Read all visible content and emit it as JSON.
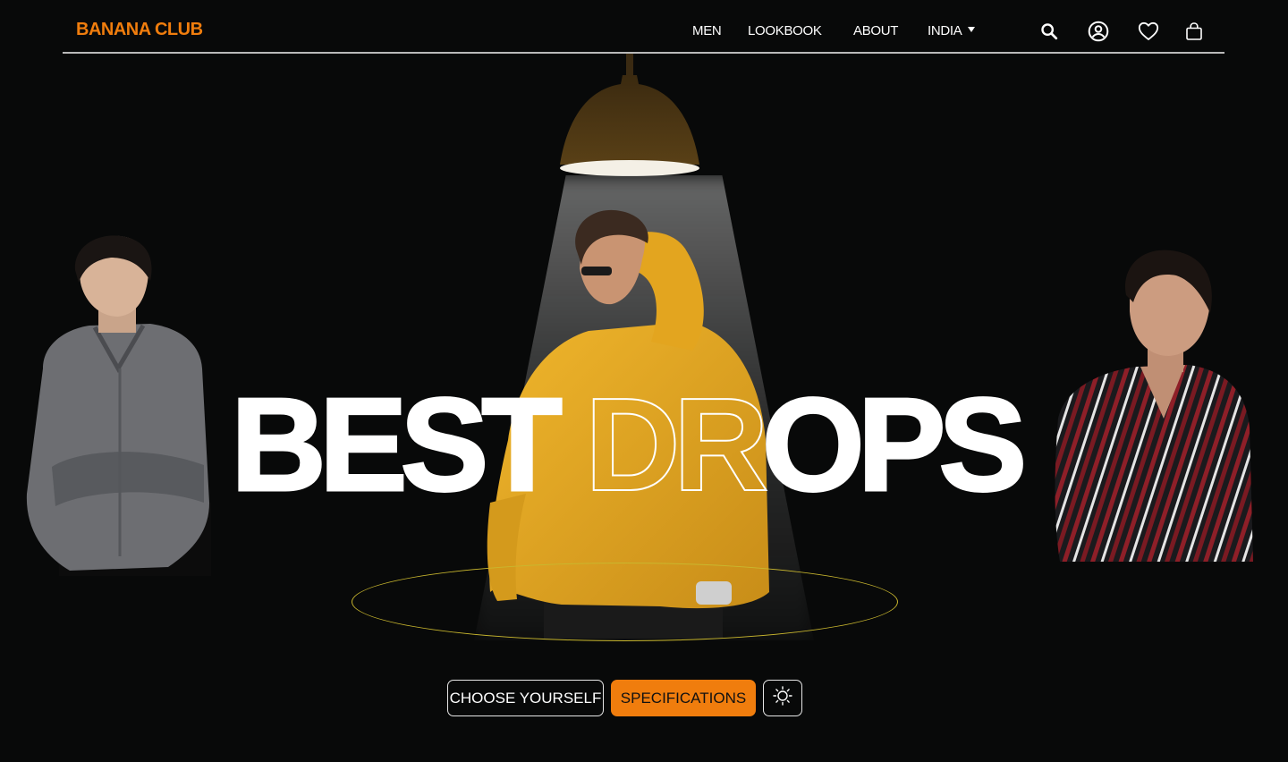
{
  "brand": {
    "name": "BANANA CLUB",
    "color": "#f07d0d"
  },
  "nav": {
    "items": [
      {
        "label": "MEN"
      },
      {
        "label": "LOOKBOOK"
      },
      {
        "label": "ABOUT"
      },
      {
        "label": "INDIA"
      }
    ],
    "icons": [
      "search-icon",
      "user-icon",
      "heart-icon",
      "bag-icon"
    ]
  },
  "hero": {
    "headline_solid_1": "BEST",
    "headline_outline": "DR",
    "headline_solid_2": "OPS"
  },
  "actions": {
    "choose_label": "CHOOSE YOURSELF",
    "spec_label": "SPECIFICATIONS",
    "theme_icon": "sun-icon"
  },
  "colors": {
    "background": "#080909",
    "accent": "#f07d0d",
    "ellipse": "#c9b72e",
    "hoodie": "#e0a521"
  }
}
